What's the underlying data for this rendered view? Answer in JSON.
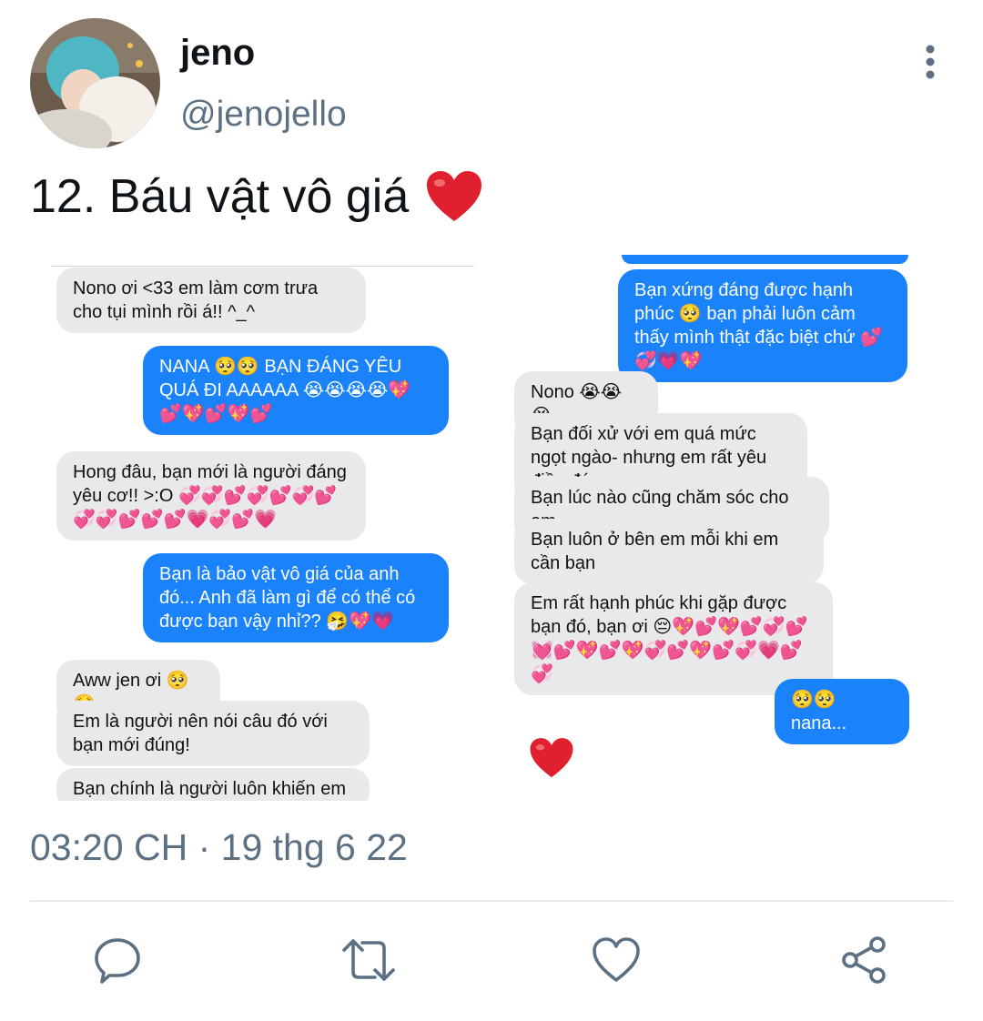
{
  "user": {
    "display_name": "jeno",
    "handle": "@jenojello"
  },
  "tweet": {
    "text": "12. Báu vật vô giá",
    "emoji": "red-heart-emoji",
    "timestamp": "03:20 CH · 19 thg 6 22"
  },
  "chat_left": [
    {
      "side": "in",
      "text": "Nono ơi <33 em làm cơm trưa cho tụi mình rồi á!! ^_^"
    },
    {
      "side": "out",
      "text": "NANA 🥺🥺 BẠN ĐÁNG YÊU QUÁ ĐI AAAAAA 😭😭😭😭💖💕💖💕💖💕"
    },
    {
      "side": "in",
      "text": "Hong đâu, bạn mới là người đáng yêu cơ!! >:O 💞💞💕💞💕💞💕💞💞💕💕💕💗💞💕💗"
    },
    {
      "side": "out",
      "text": "Bạn là bảo vật vô giá của anh đó... Anh đã làm gì để có thể có được bạn vậy nhỉ?? 🤧💖💗"
    },
    {
      "side": "in",
      "text": "Aww jen ơi 🥺🥺"
    },
    {
      "side": "in",
      "text": "Em là người nên nói câu đó với bạn mới đúng!"
    },
    {
      "side": "in",
      "text": "Bạn chính là người luôn khiến em"
    }
  ],
  "chat_right": [
    {
      "side": "out",
      "text": "Bạn xứng đáng được hạnh phúc 🥺 bạn phải luôn cảm thấy mình thật đặc biệt chứ 💕💞💗💖"
    },
    {
      "side": "in",
      "text": "Nono 😭😭😭"
    },
    {
      "side": "in",
      "text": "Bạn đối xử với em quá mức ngọt ngào- nhưng em rất yêu điều đó"
    },
    {
      "side": "in",
      "text": "Bạn lúc nào cũng chăm sóc cho em"
    },
    {
      "side": "in",
      "text": "Bạn luôn ở bên em mỗi khi em cần bạn"
    },
    {
      "side": "in",
      "text": "Em rất hạnh phúc khi gặp được bạn đó, bạn ơi 😔💖💕💖💕💞💕💓💕💖💕💖💞💕💖💕💞💗💕💞"
    },
    {
      "side": "out",
      "text": "🥺🥺 nana..."
    }
  ],
  "actions": [
    "reply-icon",
    "retweet-icon",
    "like-icon",
    "share-icon"
  ],
  "colors": {
    "imessage_blue": "#1a82fb",
    "imessage_gray": "#e9e9eb",
    "secondary_text": "#5b7083",
    "heart_red": "#e0202e"
  }
}
